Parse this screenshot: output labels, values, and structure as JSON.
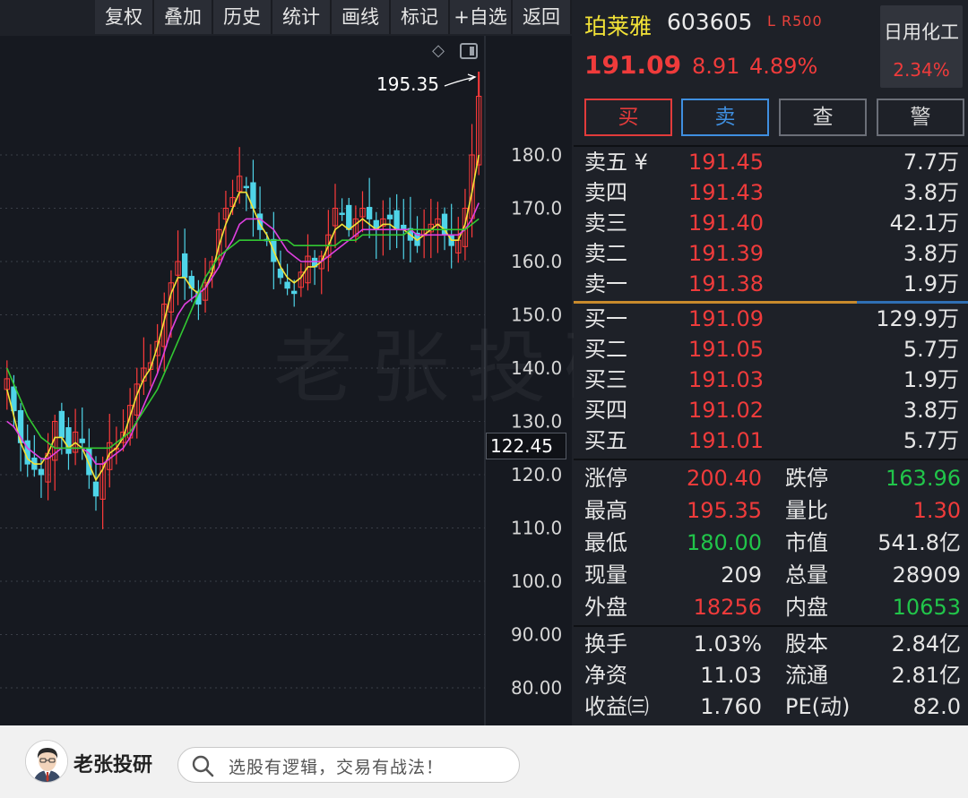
{
  "toolbar": {
    "buttons": [
      "复权",
      "叠加",
      "历史",
      "统计",
      "画线",
      "标记",
      "+自选",
      "返回"
    ]
  },
  "chart": {
    "y_axis_labels": [
      "180.0",
      "170.0",
      "160.0",
      "150.0",
      "140.0",
      "130.0",
      "120.0",
      "110.0",
      "100.0",
      "90.00",
      "80.00"
    ],
    "max_label": "195.35",
    "current_price_label": "122.45",
    "watermark": "老张投研"
  },
  "chart_data": {
    "type": "candlestick",
    "y_ticks": [
      180.0,
      170.0,
      160.0,
      150.0,
      140.0,
      130.0,
      120.0,
      110.0,
      100.0,
      90.0,
      80.0
    ],
    "ylim": [
      75,
      200
    ],
    "high_marker": 195.35,
    "series": [
      {
        "color": "#ffffff",
        "values": [
          138,
          132,
          126,
          122,
          121,
          120,
          124,
          130,
          127,
          124,
          128,
          126,
          120,
          116,
          122,
          126,
          125,
          128,
          133,
          137,
          140,
          141,
          145,
          152,
          156,
          160,
          157,
          155,
          152,
          156,
          160,
          166,
          170,
          172,
          176,
          174,
          170,
          166,
          164,
          160,
          157,
          155,
          154,
          158,
          161,
          159,
          161,
          165,
          170,
          169,
          166,
          168,
          170,
          168,
          166,
          168,
          168,
          166,
          166,
          164,
          163,
          166,
          167,
          168,
          165,
          163,
          164,
          170,
          180,
          191
        ]
      },
      {
        "color": "#f3e337",
        "values": [
          136,
          131,
          126,
          123,
          122,
          122,
          124,
          127,
          127,
          125,
          126,
          125,
          122,
          119,
          121,
          124,
          125,
          127,
          131,
          135,
          138,
          140,
          144,
          149,
          154,
          157,
          157,
          155,
          154,
          155,
          158,
          163,
          167,
          170,
          173,
          173,
          170,
          167,
          165,
          162,
          159,
          157,
          156,
          157,
          159,
          159,
          160,
          163,
          166,
          167,
          166,
          167,
          168,
          167,
          166,
          167,
          167,
          166,
          166,
          165,
          164,
          165,
          166,
          167,
          166,
          164,
          164,
          167,
          173,
          180
        ]
      },
      {
        "color": "#e040e0",
        "values": [
          130,
          129,
          127,
          125,
          124,
          123,
          123,
          124,
          125,
          125,
          125,
          125,
          124,
          122,
          122,
          123,
          124,
          125,
          127,
          130,
          133,
          136,
          139,
          143,
          147,
          150,
          152,
          153,
          154,
          155,
          157,
          159,
          162,
          164,
          167,
          168,
          168,
          168,
          167,
          166,
          164,
          162,
          161,
          160,
          160,
          160,
          160,
          161,
          162,
          163,
          164,
          165,
          166,
          166,
          166,
          166,
          166,
          166,
          166,
          166,
          165,
          165,
          165,
          165,
          165,
          165,
          165,
          166,
          168,
          171
        ]
      },
      {
        "color": "#32c832",
        "values": [
          140,
          137,
          134,
          131,
          129,
          127,
          126,
          125,
          125,
          125,
          125,
          125,
          125,
          125,
          125,
          125,
          126,
          127,
          128,
          130,
          132,
          134,
          136,
          139,
          142,
          145,
          148,
          151,
          154,
          157,
          159,
          161,
          162,
          163,
          164,
          164,
          164,
          164,
          164,
          164,
          164,
          164,
          163,
          163,
          163,
          163,
          163,
          163,
          163,
          164,
          164,
          164,
          165,
          165,
          165,
          165,
          165,
          165,
          165,
          166,
          166,
          166,
          166,
          166,
          166,
          166,
          166,
          166,
          167,
          168
        ]
      }
    ]
  },
  "stock": {
    "name": "珀莱雅",
    "code": "603605",
    "flags": "L R500",
    "price": "191.09",
    "change": "8.91",
    "change_pct": "4.89%",
    "sector_name": "日用化工",
    "sector_pct": "2.34%"
  },
  "actions": {
    "buy": "买",
    "sell": "卖",
    "query": "查",
    "alert": "警"
  },
  "order_book": {
    "asks": [
      {
        "label": "卖五 ¥",
        "price": "191.45",
        "volume": "7.7万"
      },
      {
        "label": "卖四",
        "price": "191.43",
        "volume": "3.8万"
      },
      {
        "label": "卖三",
        "price": "191.40",
        "volume": "42.1万"
      },
      {
        "label": "卖二",
        "price": "191.39",
        "volume": "3.8万"
      },
      {
        "label": "卖一",
        "price": "191.38",
        "volume": "1.9万"
      }
    ],
    "bids": [
      {
        "label": "买一",
        "price": "191.09",
        "volume": "129.9万"
      },
      {
        "label": "买二",
        "price": "191.05",
        "volume": "5.7万"
      },
      {
        "label": "买三",
        "price": "191.03",
        "volume": "1.9万"
      },
      {
        "label": "买四",
        "price": "191.02",
        "volume": "3.8万"
      },
      {
        "label": "买五",
        "price": "191.01",
        "volume": "5.7万"
      }
    ]
  },
  "stats": {
    "group1": [
      {
        "l1": "涨停",
        "v1": "200.40",
        "c1": "red",
        "l2": "跌停",
        "v2": "163.96",
        "c2": "green"
      },
      {
        "l1": "最高",
        "v1": "195.35",
        "c1": "red",
        "l2": "量比",
        "v2": "1.30",
        "c2": "red"
      },
      {
        "l1": "最低",
        "v1": "180.00",
        "c1": "green",
        "l2": "市值",
        "v2": "541.8亿",
        "c2": "white"
      },
      {
        "l1": "现量",
        "v1": "209",
        "c1": "white",
        "l2": "总量",
        "v2": "28909",
        "c2": "white"
      },
      {
        "l1": "外盘",
        "v1": "18256",
        "c1": "red",
        "l2": "内盘",
        "v2": "10653",
        "c2": "green"
      }
    ],
    "group2": [
      {
        "l1": "换手",
        "v1": "1.03%",
        "c1": "white",
        "l2": "股本",
        "v2": "2.84亿",
        "c2": "white"
      },
      {
        "l1": "净资",
        "v1": "11.03",
        "c1": "white",
        "l2": "流通",
        "v2": "2.81亿",
        "c2": "white"
      },
      {
        "l1": "收益㈢",
        "v1": "1.760",
        "c1": "white",
        "l2": "PE(动)",
        "v2": "82.0",
        "c2": "white"
      }
    ]
  },
  "footer": {
    "brand": "老张投研",
    "search_text": "选股有逻辑，交易有战法！"
  }
}
